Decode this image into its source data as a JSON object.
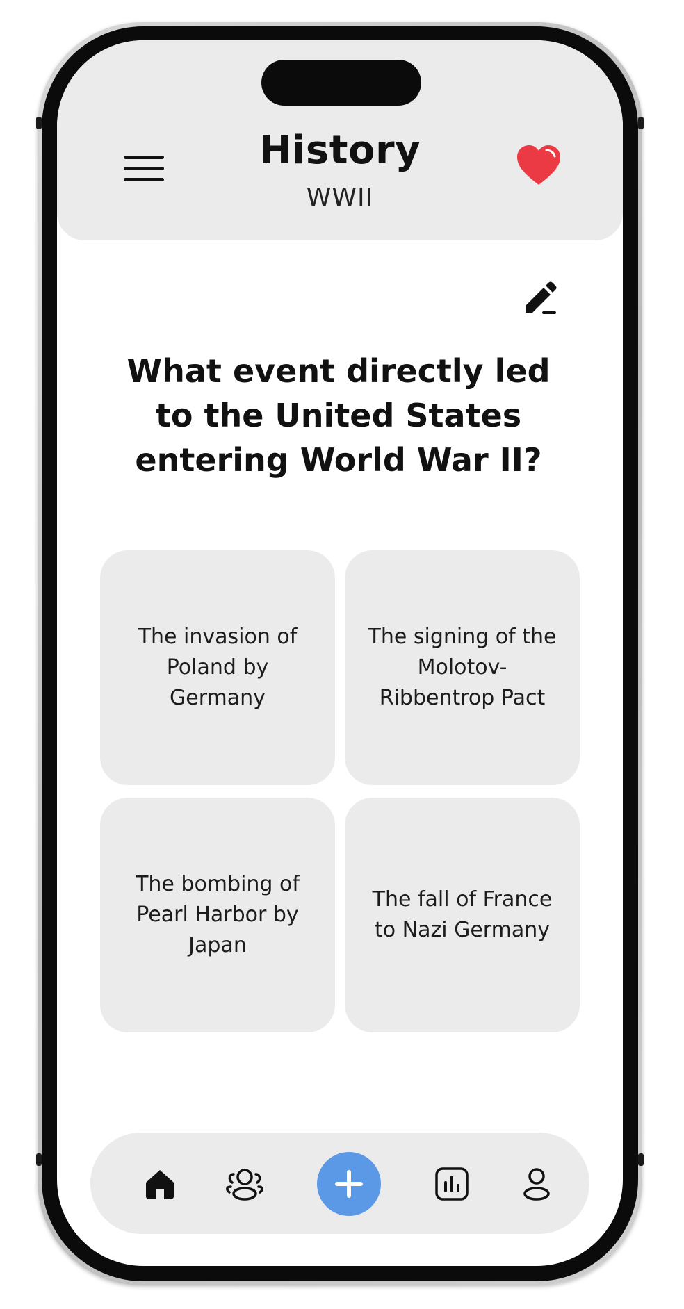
{
  "header": {
    "title": "History",
    "subtitle": "WWII",
    "menu_icon": "hamburger-menu-icon",
    "favorite_icon": "heart-icon",
    "favorite_color": "#ec3a45"
  },
  "question": {
    "edit_icon": "pencil-icon",
    "text": "What event directly led to the United States entering World War II?"
  },
  "answers": [
    {
      "label": "The invasion of Poland by Germany"
    },
    {
      "label": "The signing of the Molotov-Ribbentrop Pact"
    },
    {
      "label": "The bombing of Pearl Harbor by Japan"
    },
    {
      "label": "The fall of France to Nazi Germany"
    }
  ],
  "bottom_nav": {
    "items": [
      {
        "icon": "home-icon"
      },
      {
        "icon": "community-icon"
      },
      {
        "icon": "add-icon"
      },
      {
        "icon": "stats-icon"
      },
      {
        "icon": "profile-icon"
      }
    ],
    "accent_color": "#5b98e6"
  }
}
